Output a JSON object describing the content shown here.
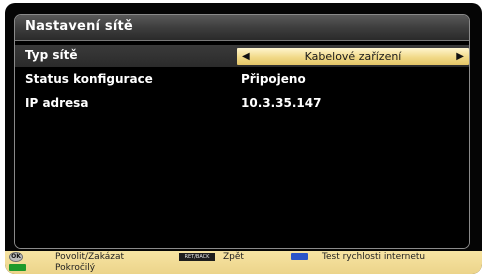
{
  "window": {
    "title": "Nastavení sítě"
  },
  "settings": [
    {
      "label": "Typ sítě",
      "value": "Kabelové zařízení"
    },
    {
      "label": "Status konfigurace",
      "value": "Připojeno"
    },
    {
      "label": "IP adresa",
      "value": "10.3.35.147"
    }
  ],
  "footer": {
    "ok_key": "OK",
    "ok_action": "Povolit/Zakázat",
    "back_key": "RET/BACK",
    "back_action": "Zpět",
    "blue_action": "Test rychlosti internetu",
    "green_action": "Pokročilý"
  },
  "colors": {
    "selector": "#f1d988",
    "footer": "#f3dc95",
    "blue_key": "#2a55c9",
    "green_key": "#1e9a2a"
  }
}
